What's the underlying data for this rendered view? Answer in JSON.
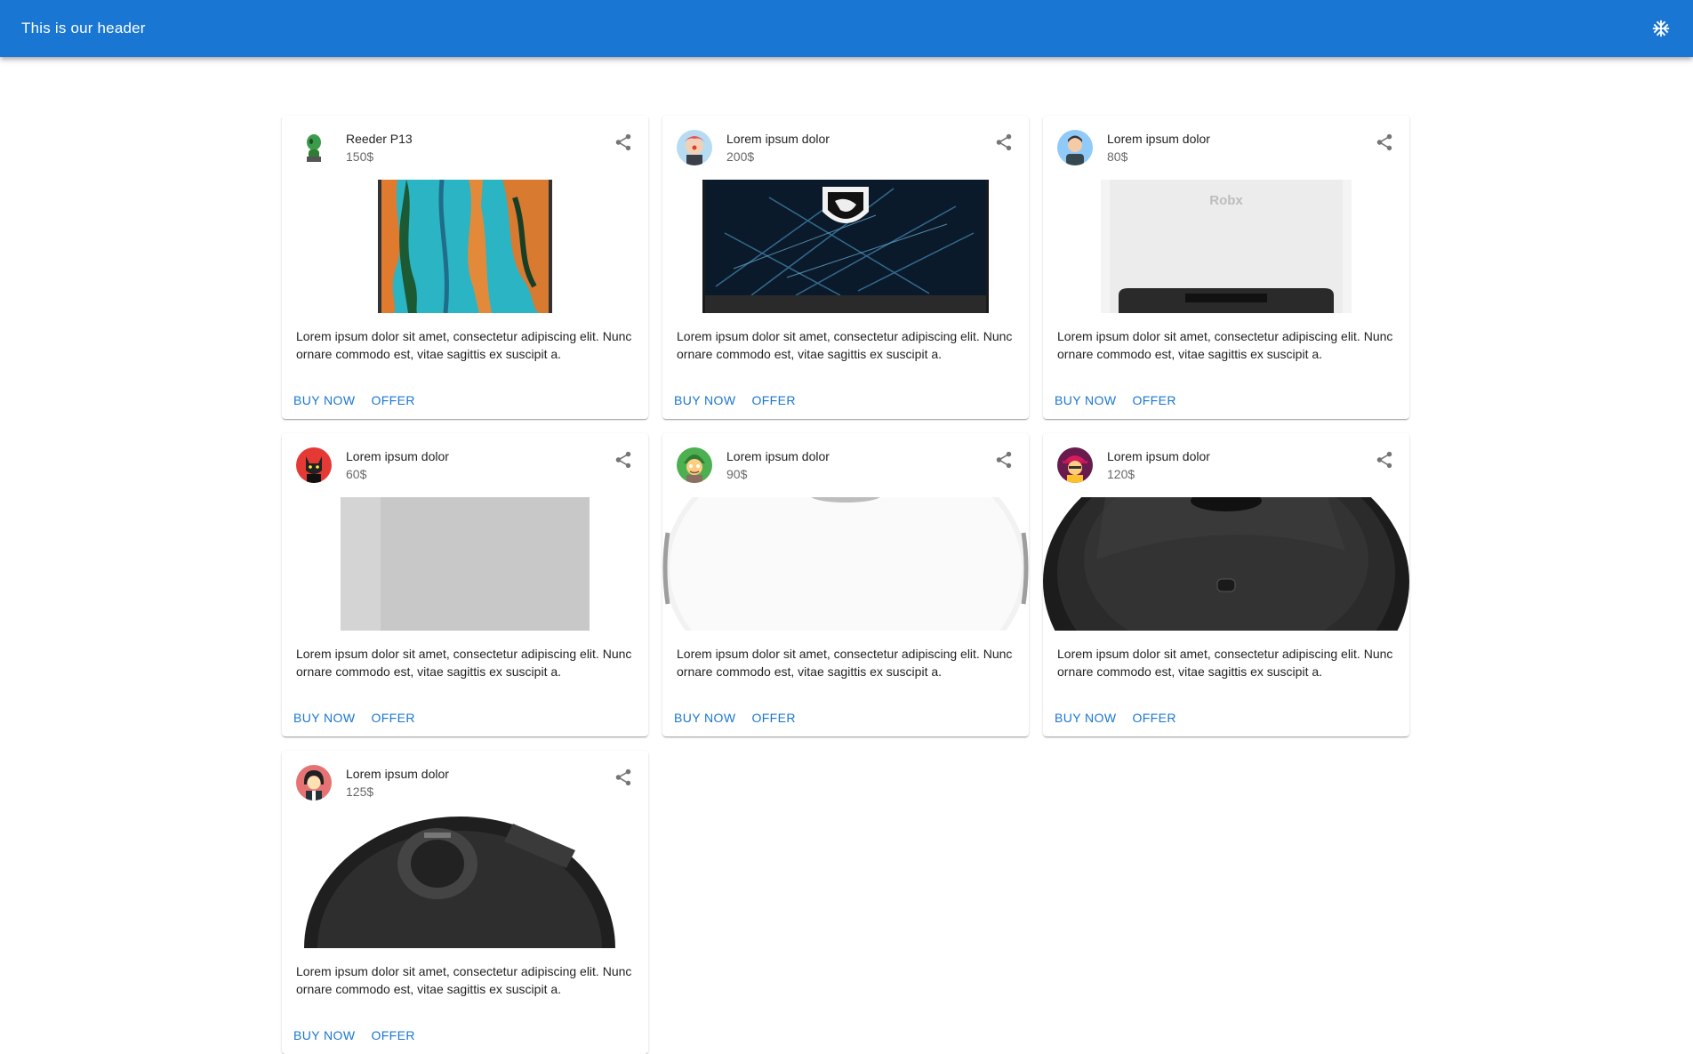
{
  "header": {
    "title": "This is our header",
    "icon": "snowflake-icon"
  },
  "cards": [
    {
      "title": "Reeder P13",
      "price": "150$",
      "description": "Lorem ipsum dolor sit amet, consectetur adipiscing elit. Nunc ornare commodo est, vitae sagittis ex suscipit a.",
      "buy_label": "BUY NOW",
      "offer_label": "OFFER",
      "image": "phone-image",
      "avatar": "alien-avatar"
    },
    {
      "title": "Lorem ipsum dolor",
      "price": "200$",
      "description": "Lorem ipsum dolor sit amet, consectetur adipiscing elit. Nunc ornare commodo est, vitae sagittis ex suscipit a.",
      "buy_label": "BUY NOW",
      "offer_label": "OFFER",
      "image": "laptop-image",
      "avatar": "clown-avatar"
    },
    {
      "title": "Lorem ipsum dolor",
      "price": "80$",
      "description": "Lorem ipsum dolor sit amet, consectetur adipiscing elit. Nunc ornare commodo est, vitae sagittis ex suscipit a.",
      "buy_label": "BUY NOW",
      "offer_label": "OFFER",
      "image": "robot-vacuum-station-image",
      "avatar": "man-avatar",
      "image_text": "Robx"
    },
    {
      "title": "Lorem ipsum dolor",
      "price": "60$",
      "description": "Lorem ipsum dolor sit amet, consectetur adipiscing elit. Nunc ornare commodo est, vitae sagittis ex suscipit a.",
      "buy_label": "BUY NOW",
      "offer_label": "OFFER",
      "image": "gray-box-image",
      "avatar": "cat-avatar"
    },
    {
      "title": "Lorem ipsum dolor",
      "price": "90$",
      "description": "Lorem ipsum dolor sit amet, consectetur adipiscing elit. Nunc ornare commodo est, vitae sagittis ex suscipit a.",
      "buy_label": "BUY NOW",
      "offer_label": "OFFER",
      "image": "white-robot-vacuum-image",
      "avatar": "elf-avatar"
    },
    {
      "title": "Lorem ipsum dolor",
      "price": "120$",
      "description": "Lorem ipsum dolor sit amet, consectetur adipiscing elit. Nunc ornare commodo est, vitae sagittis ex suscipit a.",
      "buy_label": "BUY NOW",
      "offer_label": "OFFER",
      "image": "black-robot-vacuum-image",
      "avatar": "hat-avatar"
    },
    {
      "title": "Lorem ipsum dolor",
      "price": "125$",
      "description": "Lorem ipsum dolor sit amet, consectetur adipiscing elit. Nunc ornare commodo est, vitae sagittis ex suscipit a.",
      "buy_label": "BUY NOW",
      "offer_label": "OFFER",
      "image": "dark-robot-vacuum-image",
      "avatar": "woman-avatar"
    }
  ],
  "colors": {
    "primary": "#1976d2",
    "accent_text": "#1976d2"
  }
}
